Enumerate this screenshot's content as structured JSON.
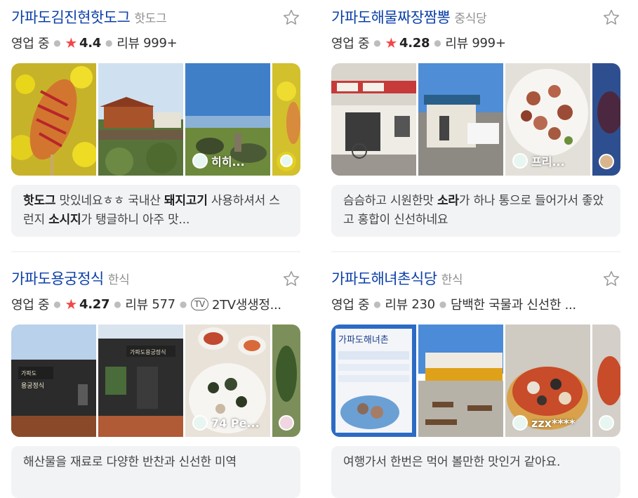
{
  "cards": [
    {
      "name": "가파도김진현핫도그",
      "category": "핫도그",
      "status": "영업 중",
      "rating": "4.4",
      "review_label": "리뷰",
      "review_count": "999+",
      "extra": "",
      "photos": [
        {
          "label": ""
        },
        {
          "label": ""
        },
        {
          "label": "히히..."
        },
        {
          "label": ""
        }
      ],
      "review_parts": [
        "핫도그",
        " 맛있네요ㅎㅎ 국내산 ",
        "돼지고기",
        " 사용하셔서 스런지 ",
        "소시지",
        "가 탱글하니 아주 맛..."
      ]
    },
    {
      "name": "가파도해물짜장짬뽕",
      "category": "중식당",
      "status": "영업 중",
      "rating": "4.28",
      "review_label": "리뷰",
      "review_count": "999+",
      "extra": "",
      "photos": [
        {
          "label": ""
        },
        {
          "label": ""
        },
        {
          "label": "프리..."
        },
        {
          "label": ""
        }
      ],
      "review_parts": [
        "슴슴하고 시원한맛 ",
        "소라",
        "가 하나 통으로 들어가서 좋았고 홍합이 신선하네요",
        "",
        "",
        ""
      ]
    },
    {
      "name": "가파도용궁정식",
      "category": "한식",
      "status": "영업 중",
      "rating": "4.27",
      "review_label": "리뷰",
      "review_count": "577",
      "extra": "2TV생생정...",
      "tv_badge": "TV",
      "photos": [
        {
          "label": ""
        },
        {
          "label": ""
        },
        {
          "label": "74 Pe..."
        },
        {
          "label": ""
        }
      ],
      "review_parts": [
        "해산물을 재료로 다양한 반찬과 신선한 미역",
        "",
        "",
        "",
        "",
        ""
      ]
    },
    {
      "name": "가파도해녀촌식당",
      "category": "한식",
      "status": "영업 중",
      "rating": "",
      "review_label": "리뷰",
      "review_count": "230",
      "extra": "담백한 국물과 신선한 ...",
      "photos": [
        {
          "label": ""
        },
        {
          "label": ""
        },
        {
          "label": "zzx****"
        },
        {
          "label": ""
        }
      ],
      "review_parts": [
        "여행가서 한번은 먹어 볼만한 맛인거 같아요.",
        "",
        "",
        "",
        "",
        ""
      ]
    }
  ],
  "icons": {
    "bookmark": "star-outline-icon",
    "rating": "star-filled-icon",
    "tv": "tv-badge-icon",
    "avatar": "user-avatar-icon"
  },
  "colors": {
    "name": "#0b3fa8",
    "rating_star": "#f24848",
    "review_bg": "#f2f3f5"
  }
}
